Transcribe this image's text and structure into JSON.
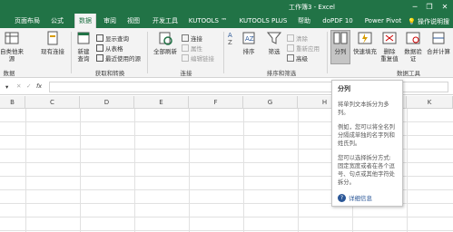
{
  "window": {
    "title": "工作簿3  -  Excel",
    "accent": "#217346"
  },
  "tabs": [
    "页面布局",
    "公式",
    "数据",
    "审阅",
    "视图",
    "开发工具",
    "KUTOOLS ™",
    "KUTOOLS PLUS",
    "帮助",
    "doPDF 10",
    "Power Pivot"
  ],
  "active_tab": "数据",
  "tell_me": "操作说明搜",
  "ribbon": {
    "get_transform": {
      "from_source_label": "自类他来源",
      "existing_conn_label": "现有连接",
      "new_query_label": "新建\n查询",
      "show_query": "显示查询",
      "from_table": "从表格",
      "recent_sources": "最近使用的源",
      "group_label": "获取和转换",
      "left_group_label": "数据"
    },
    "connections": {
      "refresh_all_label": "全部刷新",
      "connections": "连接",
      "properties": "属性",
      "edit_links": "编辑链接",
      "group_label": "连接"
    },
    "sort_filter": {
      "sort_label": "排序",
      "filter_label": "筛选",
      "clear": "清除",
      "reapply": "重新应用",
      "advanced": "高级",
      "group_label": "排序和筛选"
    },
    "data_tools": {
      "text_to_columns_label": "分列",
      "flash_fill_label": "快速填充",
      "remove_dup_label": "删除\n重复值",
      "validation_label": "数据验\n证",
      "consolidate_label": "合并计算",
      "group_label": "数据工具"
    }
  },
  "formula_bar": {
    "fx": "fx",
    "name_box": ""
  },
  "columns": [
    "B",
    "C",
    "D",
    "E",
    "F",
    "G",
    "H",
    "I",
    "K"
  ],
  "tooltip": {
    "title": "分列",
    "para1": "将单列文本拆分为多列。",
    "para2": "例如，您可以将全名列分隔成单独的名字列和姓氏列。",
    "para3": "您可以选择拆分方式: 固定宽度或者在各个逗号、句点或其他字符处拆分。",
    "more": "详细信息"
  }
}
